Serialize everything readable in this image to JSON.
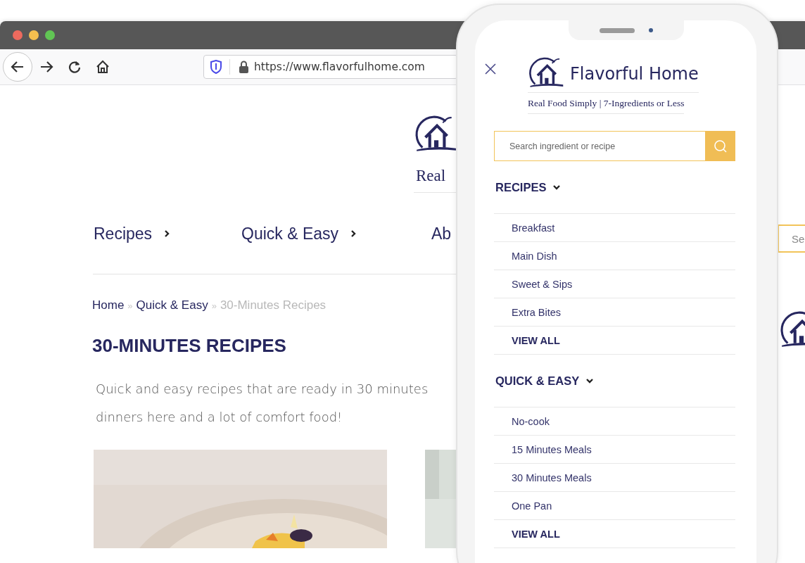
{
  "browser": {
    "url": "https://www.flavorfulhome.com",
    "page": {
      "logo_tagline": "Real",
      "nav": [
        {
          "label": "Recipes",
          "kind": "dropdown"
        },
        {
          "label": "Quick & Easy",
          "kind": "dropdown"
        },
        {
          "label": "Ab",
          "kind": "plain"
        }
      ],
      "breadcrumb": [
        {
          "label": "Home",
          "kind": "link"
        },
        {
          "label": "»",
          "kind": "separator"
        },
        {
          "label": "Quick & Easy",
          "kind": "link"
        },
        {
          "label": "»",
          "kind": "separator"
        },
        {
          "label": "30-Minutes Recipes",
          "kind": "current"
        }
      ],
      "heading": "30-MINUTES RECIPES",
      "intro_lines": [
        "Quick and easy recipes that are ready in 30 minutes",
        "dinners here and a lot of comfort food!"
      ],
      "cards": [
        {
          "kind": "picture"
        },
        {
          "kind": "picture"
        }
      ],
      "side_search": {
        "placeholder": "Se"
      }
    }
  },
  "phone": {
    "brand": "Flavorful Home",
    "tagline": "Real Food Simply | 7-Ingredients or Less",
    "search": {
      "placeholder": "Search ingredient or recipe"
    },
    "sections": [
      {
        "title": "RECIPES",
        "expanded": true,
        "items": [
          {
            "label": "Breakfast",
            "kind": "link"
          },
          {
            "label": "Main Dish",
            "kind": "link"
          },
          {
            "label": "Sweet & Sips",
            "kind": "link"
          },
          {
            "label": "Extra Bites",
            "kind": "link"
          },
          {
            "label": "VIEW ALL",
            "kind": "view_all"
          }
        ]
      },
      {
        "title": "QUICK & EASY",
        "expanded": true,
        "items": [
          {
            "label": "No-cook",
            "kind": "link"
          },
          {
            "label": "15 Minutes Meals",
            "kind": "link"
          },
          {
            "label": "30 Minutes Meals",
            "kind": "link"
          },
          {
            "label": "One Pan",
            "kind": "link"
          },
          {
            "label": "VIEW ALL",
            "kind": "view_all"
          }
        ]
      }
    ]
  }
}
